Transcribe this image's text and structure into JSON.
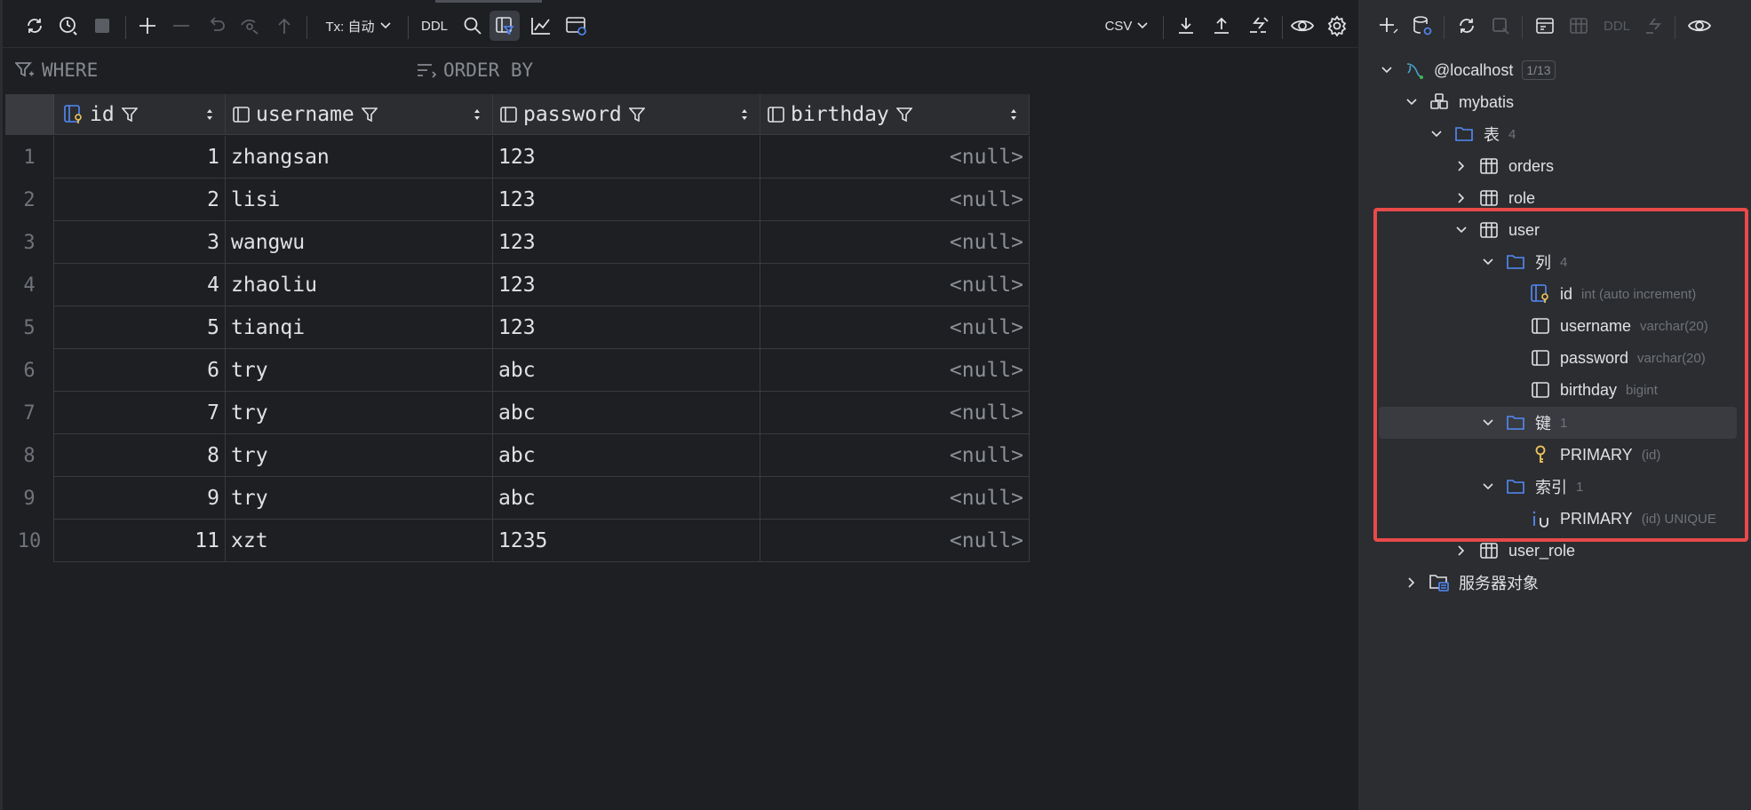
{
  "toolbar": {
    "tx_label": "Tx: 自动",
    "ddl_label": "DDL",
    "export_format": "CSV"
  },
  "filter": {
    "where_label": "WHERE",
    "order_label": "ORDER BY"
  },
  "grid": {
    "columns": [
      "id",
      "username",
      "password",
      "birthday"
    ],
    "rows": [
      {
        "n": "1",
        "id": "1",
        "username": "zhangsan",
        "password": "123",
        "birthday": "<null>"
      },
      {
        "n": "2",
        "id": "2",
        "username": "lisi",
        "password": "123",
        "birthday": "<null>"
      },
      {
        "n": "3",
        "id": "3",
        "username": "wangwu",
        "password": "123",
        "birthday": "<null>"
      },
      {
        "n": "4",
        "id": "4",
        "username": "zhaoliu",
        "password": "123",
        "birthday": "<null>"
      },
      {
        "n": "5",
        "id": "5",
        "username": "tianqi",
        "password": "123",
        "birthday": "<null>"
      },
      {
        "n": "6",
        "id": "6",
        "username": "try",
        "password": "abc",
        "birthday": "<null>"
      },
      {
        "n": "7",
        "id": "7",
        "username": "try",
        "password": "abc",
        "birthday": "<null>"
      },
      {
        "n": "8",
        "id": "8",
        "username": "try",
        "password": "abc",
        "birthday": "<null>"
      },
      {
        "n": "9",
        "id": "9",
        "username": "try",
        "password": "abc",
        "birthday": "<null>"
      },
      {
        "n": "10",
        "id": "11",
        "username": "xzt",
        "password": "1235",
        "birthday": "<null>"
      }
    ]
  },
  "rtoolbar": {
    "ddl_label": "DDL"
  },
  "tree": {
    "host": {
      "label": "@localhost",
      "badge": "1/13"
    },
    "schema": {
      "label": "mybatis"
    },
    "tables_folder": {
      "label": "表",
      "count": "4"
    },
    "tables": [
      "orders",
      "role",
      "user",
      "user_role"
    ],
    "columns_folder": {
      "label": "列",
      "count": "4"
    },
    "columns": [
      {
        "name": "id",
        "type": "int (auto increment)"
      },
      {
        "name": "username",
        "type": "varchar(20)"
      },
      {
        "name": "password",
        "type": "varchar(20)"
      },
      {
        "name": "birthday",
        "type": "bigint"
      }
    ],
    "keys_folder": {
      "label": "键",
      "count": "1"
    },
    "key": {
      "name": "PRIMARY",
      "detail": "(id)"
    },
    "indexes_folder": {
      "label": "索引",
      "count": "1"
    },
    "index": {
      "name": "PRIMARY",
      "detail": "(id) UNIQUE"
    },
    "server_objects": {
      "label": "服务器对象"
    }
  },
  "colors": {
    "accent_blue": "#548af7",
    "highlight_red": "#e84a4a",
    "key_yellow": "#f2c55c"
  }
}
